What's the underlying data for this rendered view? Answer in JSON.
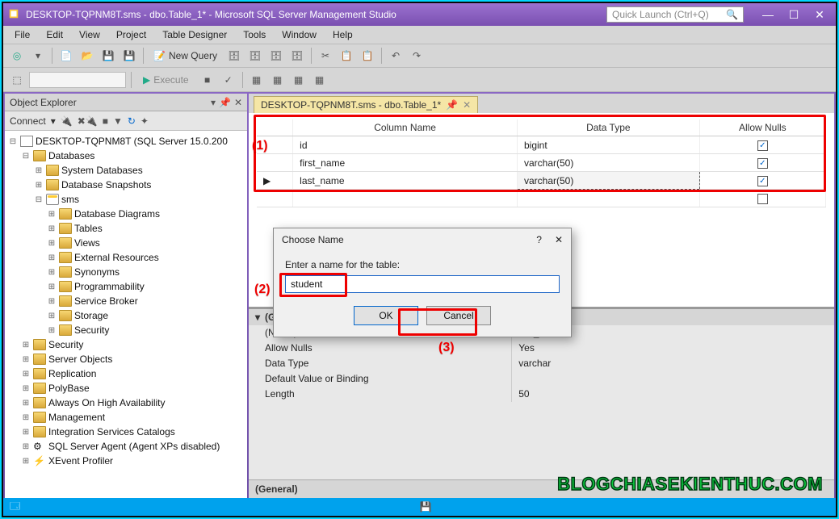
{
  "title": "DESKTOP-TQPNM8T.sms - dbo.Table_1* - Microsoft SQL Server Management Studio",
  "quick_launch_placeholder": "Quick Launch (Ctrl+Q)",
  "menu": [
    "File",
    "Edit",
    "View",
    "Project",
    "Table Designer",
    "Tools",
    "Window",
    "Help"
  ],
  "toolbar": {
    "new_query": "New Query",
    "execute": "Execute"
  },
  "oe": {
    "title": "Object Explorer",
    "connect": "Connect",
    "server": "DESKTOP-TQPNM8T (SQL Server 15.0.200",
    "databases": "Databases",
    "sysdb": "System Databases",
    "snapshots": "Database Snapshots",
    "sms": "sms",
    "sms_children": [
      "Database Diagrams",
      "Tables",
      "Views",
      "External Resources",
      "Synonyms",
      "Programmability",
      "Service Broker",
      "Storage",
      "Security"
    ],
    "root_children": [
      "Security",
      "Server Objects",
      "Replication",
      "PolyBase",
      "Always On High Availability",
      "Management",
      "Integration Services Catalogs"
    ],
    "agent": "SQL Server Agent (Agent XPs disabled)",
    "xevent": "XEvent Profiler"
  },
  "tab": {
    "label": "DESKTOP-TQPNM8T.sms - dbo.Table_1*"
  },
  "grid": {
    "headers": [
      "Column Name",
      "Data Type",
      "Allow Nulls"
    ],
    "rows": [
      {
        "name": "id",
        "type": "bigint",
        "nulls": true
      },
      {
        "name": "first_name",
        "type": "varchar(50)",
        "nulls": true
      },
      {
        "name": "last_name",
        "type": "varchar(50)",
        "nulls": true
      }
    ]
  },
  "props": {
    "section": "(General)",
    "rows": [
      {
        "k": "(Name)",
        "v": "last_name"
      },
      {
        "k": "Allow Nulls",
        "v": "Yes"
      },
      {
        "k": "Data Type",
        "v": "varchar"
      },
      {
        "k": "Default Value or Binding",
        "v": ""
      },
      {
        "k": "Length",
        "v": "50"
      }
    ],
    "footer": "(General)"
  },
  "dialog": {
    "title": "Choose Name",
    "label": "Enter a name for the table:",
    "value": "student",
    "ok": "OK",
    "cancel": "Cancel"
  },
  "callouts": {
    "c1": "(1)",
    "c2": "(2)",
    "c3": "(3)"
  },
  "watermark": "BLOGCHIASEKIENTHUC.COM"
}
